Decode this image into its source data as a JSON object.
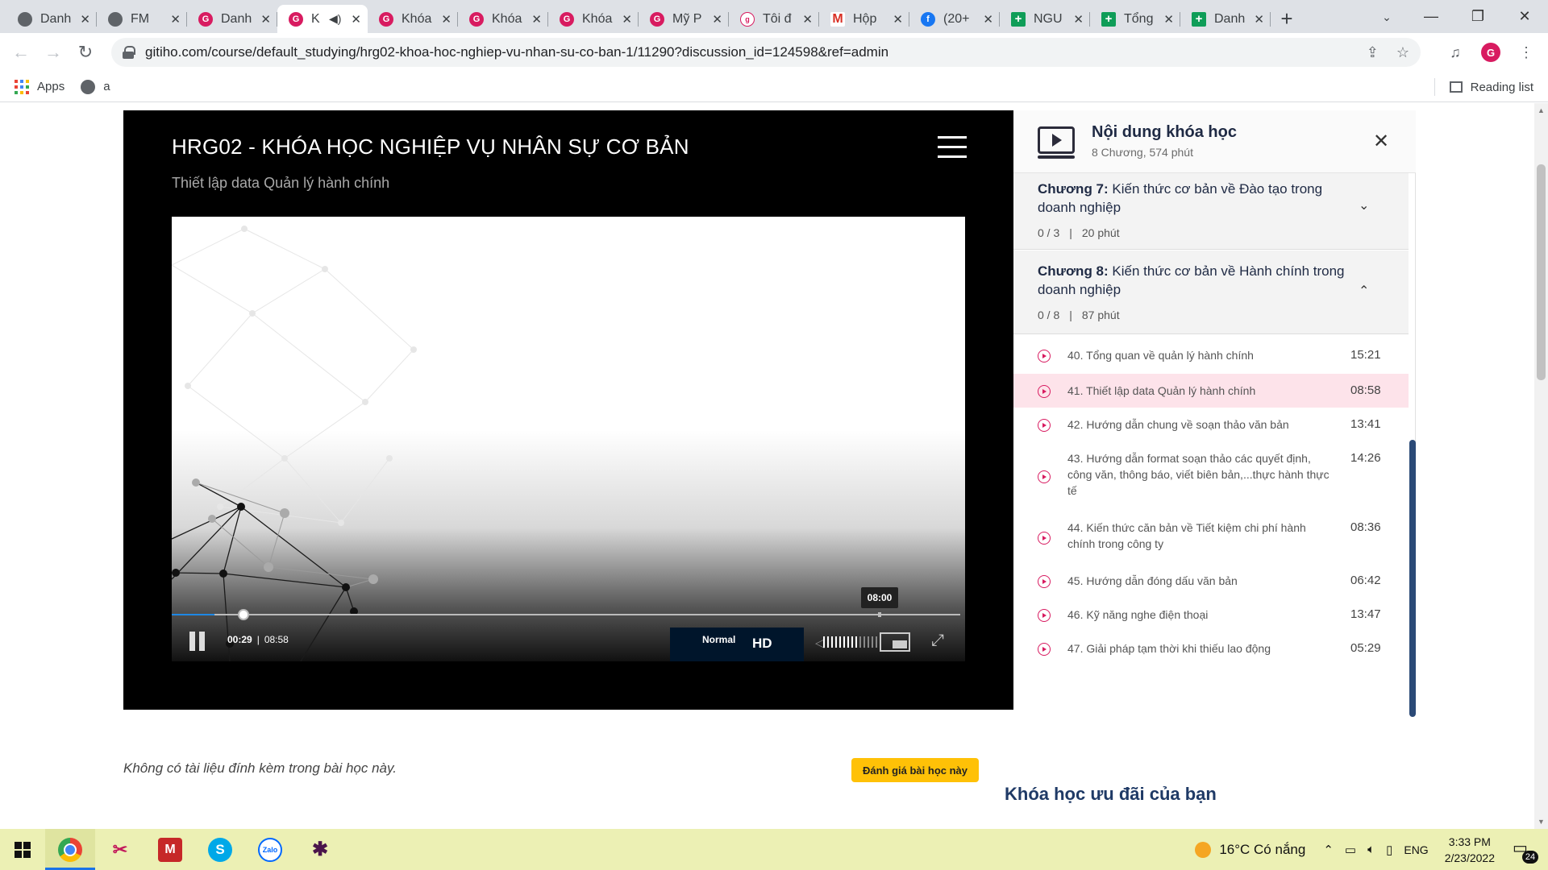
{
  "browser": {
    "tabs": [
      {
        "title": "Danh",
        "favicon": "globe"
      },
      {
        "title": "FM",
        "favicon": "globe"
      },
      {
        "title": "Danh",
        "favicon": "gitiho"
      },
      {
        "title": "K",
        "favicon": "gitiho",
        "active": true,
        "audio": true
      },
      {
        "title": "Khóa",
        "favicon": "gitiho"
      },
      {
        "title": "Khóa",
        "favicon": "gitiho"
      },
      {
        "title": "Khóa",
        "favicon": "gitiho"
      },
      {
        "title": "Mỹ P",
        "favicon": "gitiho"
      },
      {
        "title": "Tôi đ",
        "favicon": "gitiho-small"
      },
      {
        "title": "Hộp",
        "favicon": "gmail"
      },
      {
        "title": "(20+",
        "favicon": "facebook"
      },
      {
        "title": "NGU",
        "favicon": "sheets"
      },
      {
        "title": "Tổng",
        "favicon": "sheets"
      },
      {
        "title": "Danh",
        "favicon": "sheets"
      }
    ],
    "url": "gitiho.com/course/default_studying/hrg02-khoa-hoc-nghiep-vu-nhan-su-co-ban-1/11290?discussion_id=124598&ref=admin",
    "bookmarks": [
      {
        "label": "Apps",
        "icon": "apps-grid-icon"
      },
      {
        "label": "a",
        "icon": "globe-icon"
      }
    ],
    "reading_list": "Reading list"
  },
  "player": {
    "course_title": "HRG02 - KHÓA HỌC NGHIỆP VỤ NHÂN SỰ CƠ BẢN",
    "lesson_title": "Thiết lập data Quản lý hành chính",
    "current_time": "00:29",
    "duration": "08:58",
    "hover_time": "08:00",
    "progress_fraction": 0.054,
    "speed_label": "Normal",
    "quality_label": "HD",
    "progress_color": "#1e88e5"
  },
  "sidebar": {
    "title": "Nội dung khóa học",
    "meta": "8 Chương, 574 phút",
    "chapters": [
      {
        "prefix": "Chương 7:",
        "name": "Kiến thức cơ bản về Đào tạo trong doanh nghiệp",
        "progress": "0 / 3",
        "duration": "20 phút",
        "expanded": false
      },
      {
        "prefix": "Chương 8:",
        "name": "Kiến thức cơ bản về Hành chính trong doanh nghiệp",
        "progress": "0 / 8",
        "duration": "87 phút",
        "expanded": true
      }
    ],
    "lessons": [
      {
        "title": "40. Tổng quan về quản lý hành chính",
        "duration": "15:21"
      },
      {
        "title": "41. Thiết lập data Quản lý hành chính",
        "duration": "08:58",
        "active": true
      },
      {
        "title": "42. Hướng dẫn chung về soạn thảo văn bản",
        "duration": "13:41"
      },
      {
        "title": "43. Hướng dẫn format soạn thảo các quyết định, công văn, thông báo, viết biên bản,...thực hành thực tế",
        "duration": "14:26"
      },
      {
        "title": "44. Kiến thức căn bản về Tiết kiệm chi phí hành chính trong công ty",
        "duration": "08:36"
      },
      {
        "title": "45. Hướng dẫn đóng dấu văn bản",
        "duration": "06:42"
      },
      {
        "title": "46. Kỹ năng nghe điện thoại",
        "duration": "13:47"
      },
      {
        "title": "47. Giải pháp tạm thời khi thiếu lao động",
        "duration": "05:29"
      }
    ],
    "accent_color": "#d81b60",
    "active_bg": "#fde3ea"
  },
  "below": {
    "no_attachments": "Không có tài liệu đính kèm trong bài học này.",
    "rate_button": "Đánh giá bài học này",
    "promo_heading": "Khóa học ưu đãi của bạn"
  },
  "taskbar": {
    "apps": [
      "chrome-icon",
      "snipping-tool-icon",
      "mcafee-icon",
      "skype-icon",
      "zalo-icon",
      "slack-icon"
    ],
    "weather_temp": "16°C",
    "weather_text": "Có nắng",
    "language": "ENG",
    "time": "3:33 PM",
    "date": "2/23/2022",
    "notification_count": "24"
  }
}
